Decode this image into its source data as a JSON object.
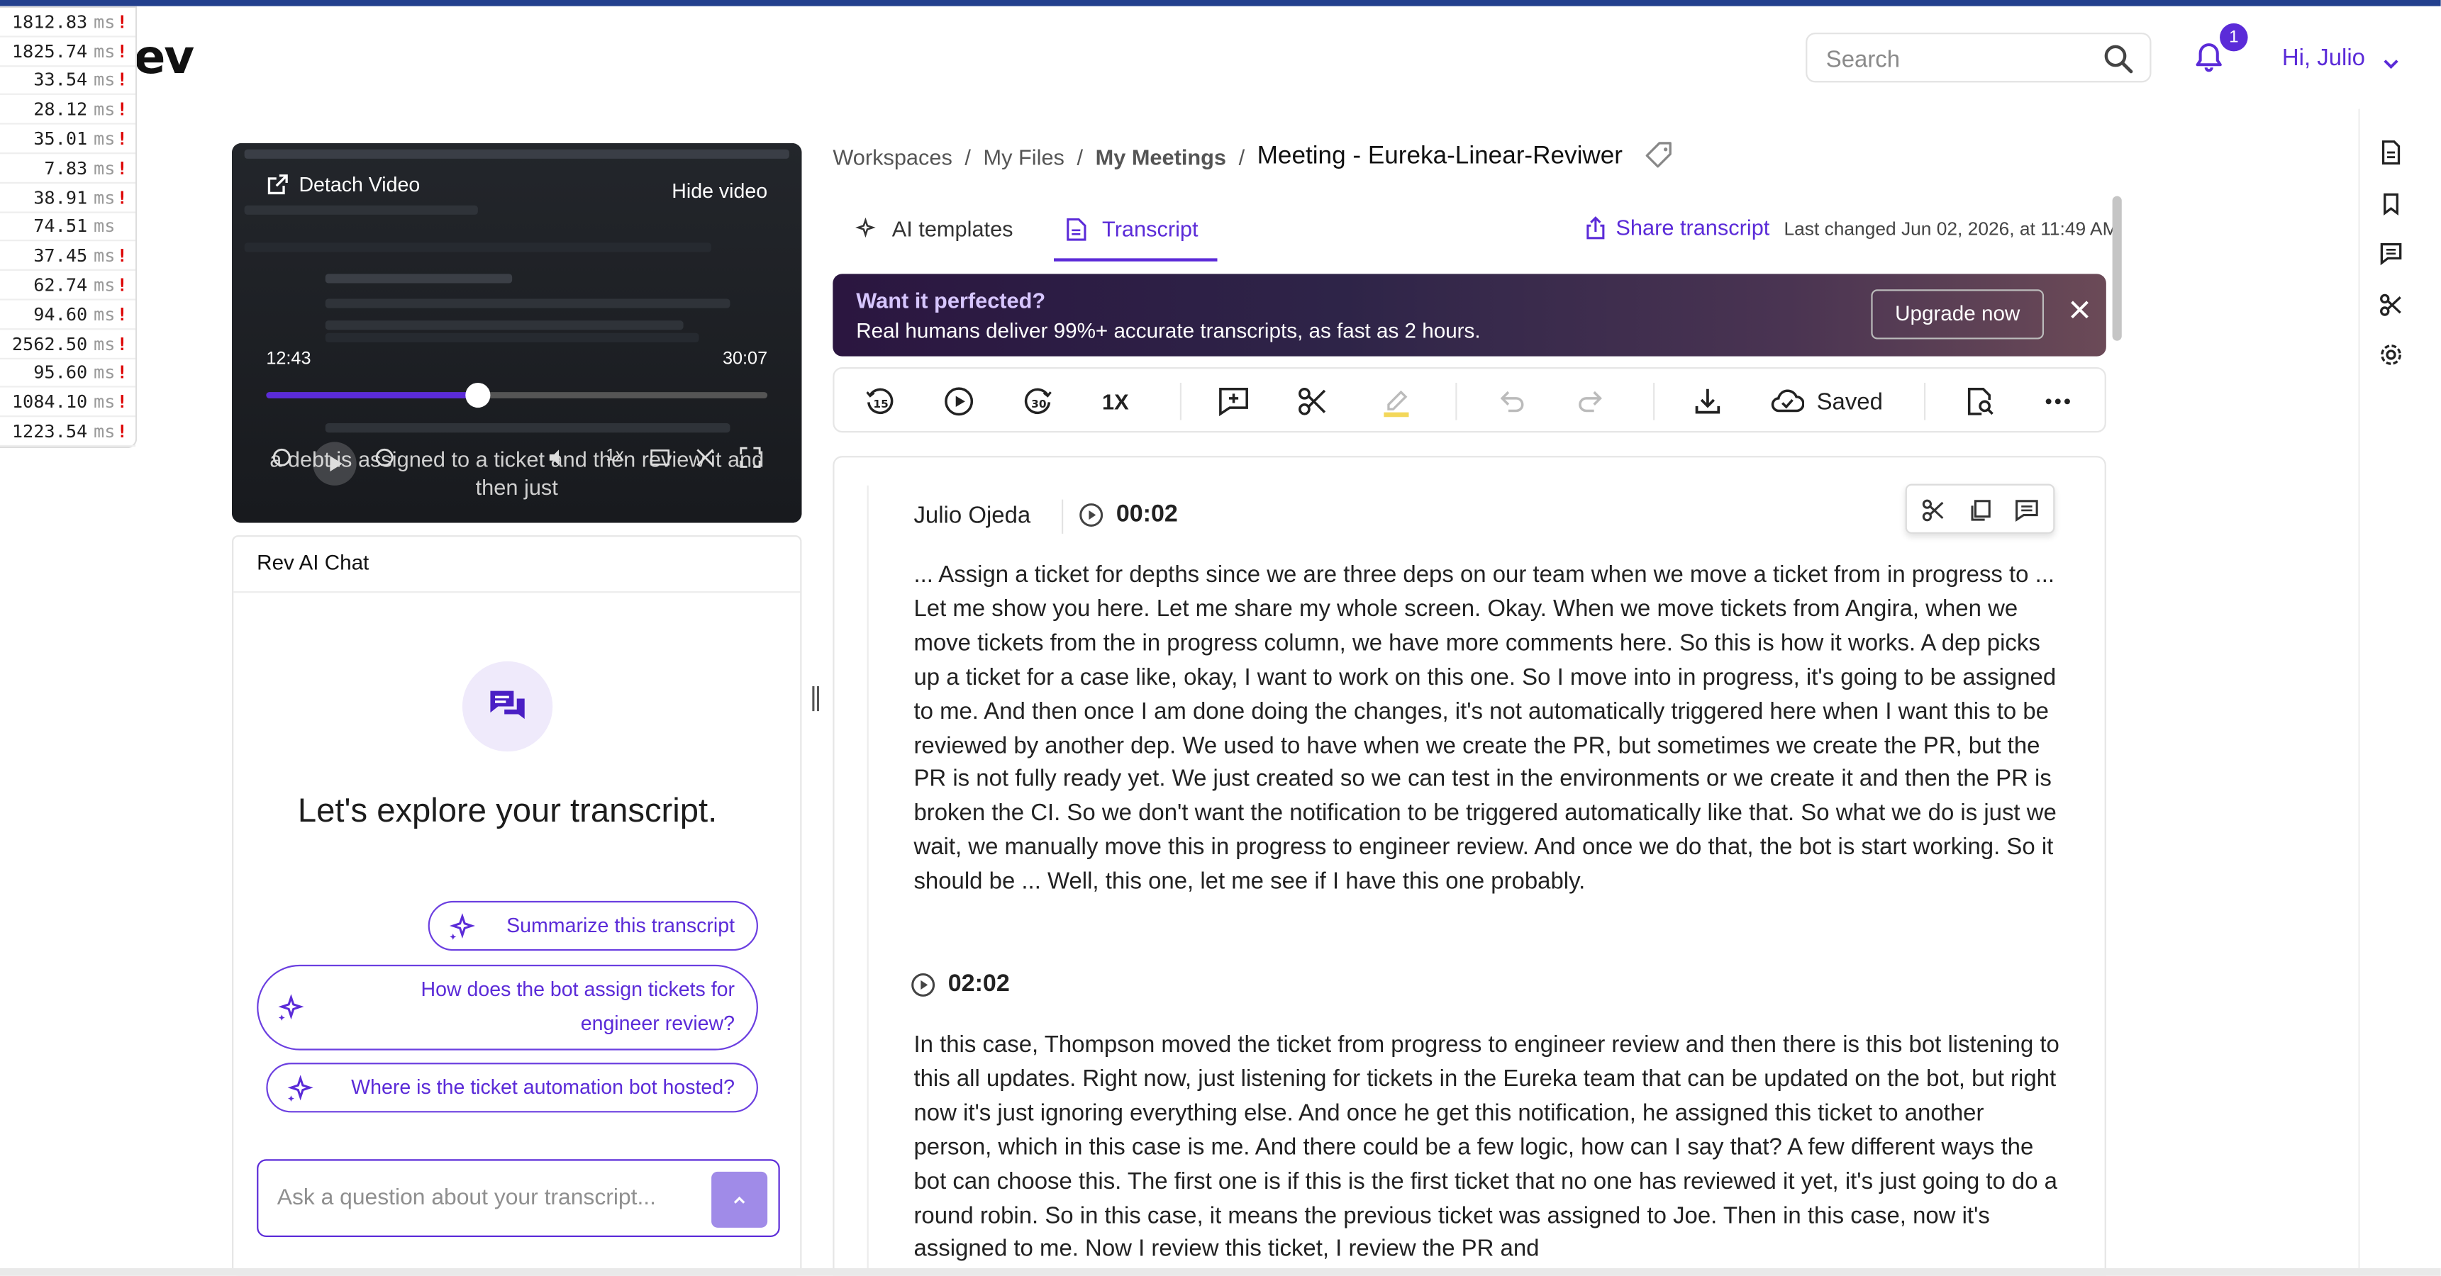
{
  "perf": [
    {
      "value": "1812.83",
      "unit": "ms",
      "flag": "!"
    },
    {
      "value": "1825.74",
      "unit": "ms",
      "flag": "!"
    },
    {
      "value": "33.54",
      "unit": "ms",
      "flag": "!"
    },
    {
      "value": "28.12",
      "unit": "ms",
      "flag": "!"
    },
    {
      "value": "35.01",
      "unit": "ms",
      "flag": "!"
    },
    {
      "value": "7.83",
      "unit": "ms",
      "flag": "!"
    },
    {
      "value": "38.91",
      "unit": "ms",
      "flag": "!"
    },
    {
      "value": "74.51",
      "unit": "ms",
      "flag": ""
    },
    {
      "value": "37.45",
      "unit": "ms",
      "flag": "!"
    },
    {
      "value": "62.74",
      "unit": "ms",
      "flag": "!"
    },
    {
      "value": "94.60",
      "unit": "ms",
      "flag": "!"
    },
    {
      "value": "2562.50",
      "unit": "ms",
      "flag": "!"
    },
    {
      "value": "95.60",
      "unit": "ms",
      "flag": "!"
    },
    {
      "value": "1084.10",
      "unit": "ms",
      "flag": "!"
    },
    {
      "value": "1223.54",
      "unit": "ms",
      "flag": "!"
    }
  ],
  "header": {
    "logo": "ev",
    "search_placeholder": "Search",
    "notification_count": "1",
    "user_greeting": "Hi, Julio"
  },
  "video": {
    "detach_label": "Detach Video",
    "hide_label": "Hide video",
    "current_time": "12:43",
    "duration": "30:07",
    "progress_fraction": 0.422,
    "caption": "a debt is assigned to a ticket and then review it and then just",
    "speed": "1x"
  },
  "chat": {
    "title": "Rev AI Chat",
    "heading": "Let's explore your transcript.",
    "suggestions": [
      "Summarize this transcript",
      "How does the bot assign tickets for engineer review?",
      "Where is the ticket automation bot hosted?"
    ],
    "input_placeholder": "Ask a question about your transcript..."
  },
  "breadcrumb": {
    "items": [
      "Workspaces",
      "My Files",
      "My Meetings"
    ],
    "separator": "/",
    "current": "Meeting - Eureka-Linear-Reviwer"
  },
  "tabs": {
    "ai_templates": "AI templates",
    "transcript": "Transcript"
  },
  "share": {
    "label": "Share transcript",
    "last_changed": "Last changed Jun 02, 2026, at 11:49 AM"
  },
  "banner": {
    "title": "Want it perfected?",
    "subtitle": "Real humans deliver 99%+ accurate transcripts, as fast as 2 hours.",
    "button": "Upgrade now"
  },
  "toolbar": {
    "speed": "1X",
    "saved": "Saved"
  },
  "transcript": {
    "segments": [
      {
        "speaker": "Julio Ojeda",
        "time": "00:02",
        "text": "... Assign a ticket for depths since we are three deps on our team when we move a ticket from in progress to ... Let me show you here. Let me share my whole screen. Okay. When we move tickets from Angira, when we move tickets from the in progress column, we have more comments here. So this is how it works. A dep picks up a ticket for a case like, okay, I want to work on this one. So I move into in progress, it's going to be assigned to me. And then once I am done doing the changes, it's not automatically triggered here when I want this to be reviewed by another dep. We used to have when we create the PR, but sometimes we create the PR, but the PR is not fully ready yet. We just created so we can test in the environments or we create it and then the PR is broken the CI. So we don't want the notification to be triggered automatically like that. So what we do is just we wait, we manually move this in progress to engineer review. And once we do that, the bot is start working. So it should be ... Well, this one, let me see if I have this one probably."
      },
      {
        "speaker": "",
        "time": "02:02",
        "text": "In this case, Thompson moved the ticket from progress to engineer review and then there is this bot listening to this all updates. Right now, just listening for tickets in the Eureka team that can be updated on the bot, but right now it's just ignoring everything else. And once he get this notification, he assigned this ticket to another person, which in this case is me. And there could be a few logic, how can I say that? A few different ways the bot can choose this. The first one is if this is the first ticket that no one has reviewed it yet, it's just going to do a round robin. So in this case, it means the previous ticket was assigned to Joe. Then in this case, now it's assigned to me. Now I review this ticket, I review the PR and"
      }
    ]
  }
}
